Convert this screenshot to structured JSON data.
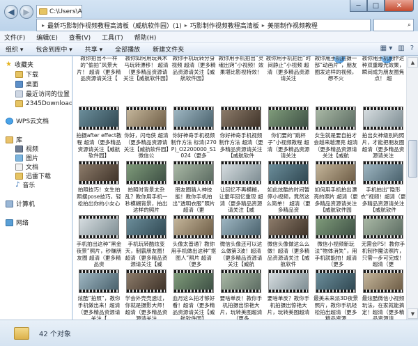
{
  "window": {
    "address_text": "C:\\Users\\Administrator\\",
    "minimize": "─",
    "maximize": "□",
    "close": "✕",
    "back": "◀",
    "forward": "▶"
  },
  "breadcrumb": {
    "items": [
      "最新巧影制作视频教程高清板（威航软件园）(1)",
      "巧影制作视频教程高清板",
      "美丽制作视频教程"
    ],
    "separator": "▸",
    "search_icon": "⌕"
  },
  "menu": {
    "items": [
      "文件(F)",
      "编辑(E)",
      "查看(V)",
      "工具(T)",
      "帮助(H)"
    ]
  },
  "commandbar": {
    "items": [
      "组织 ▾",
      "包含到库中 ▾",
      "共享 ▾",
      "全部播放",
      "新建文件夹"
    ],
    "view_icon": "▦ ▾",
    "pane_icon": "▥",
    "help_icon": "?"
  },
  "navigation": {
    "favorites": "收藏夹",
    "downloads": "下载",
    "desktop": "桌面",
    "recent": "最近访问的位置",
    "downloads2345": "2345Downloads",
    "wps_cloud": "WPS云文档",
    "libraries": "库",
    "videos": "视频",
    "pictures": "图片",
    "documents": "文档",
    "thunder": "迅雷下载",
    "music": "音乐",
    "computer": "计算机",
    "network": "网络"
  },
  "files": {
    "row1": [
      "教你拍出不一样的“偷拍”风景大片！ 超清（更多精品资源请关注【",
      "教你如何用玩具木马玩转漂移！ 超清（更多精品资源请关注【威航软件园】",
      "教你手机玩转分身视频 超清（更多精品资源请关注【威航软件园】",
      "教你用手机拍出“灵魂出窍”小视频！效果堪比影视特效！",
      "教你用手机拍出“时间静止”小视频 超清（更多精品资源请关注",
      "教你用手机拍摄一部“动画片”，朋友圈发这样的视频，想不火",
      "教你用手机制作这种双重曝光效果，瞬间成为朋友圈焦点！ 超"
    ],
    "row2": [
      "拍摄after effect教程 超清（更多精品资源请关注【威航软件园】",
      "你好，闪电侠 超清（更多精品资源请关注【威航软件园】微信公",
      "你好神奇手机视频制作方法 标清(270P)_O2200000_S1024（更多",
      "你好神奇手机视频制作方法 超清（更多精品资源请关注【威航软件",
      "你们要的“跳杯子”小视频教程 超清（更多精品资源请关注",
      "女生就是要自拍才会越来越漂亮 超清（更多精品资源请关注【威航",
      "拍出女神级别的照片，才能把朋友圈 超清（更多精品资源请关注"
    ],
    "row3": [
      "拍照技巧！女生拍照摆pose技巧，轻松拍出你的小女心",
      "拍照时背景太杂乱？教你用手机一秒模糊背景，拍出这样的照片",
      "朋友圈猜人神技能！教你手机拍出“透明衣服”照片 超清（更",
      "让回忆不再模糊，让童年回忆重现 超清（更多精品资源请关注【威",
      "如此炫酷的时间暂停小视频，竟然这么简单！ 超清（更多精品资",
      "如何用手机拍出漂亮的照片 超清（更多精品资源请关注【威航软件园",
      "手机拍出“隐形衣”视频！超清（更多精品资源请关注【威航软件"
    ],
    "row4": [
      "手机拍出这种“黑金夜景”照片，秒赚朋友圈 超清（更多精品资",
      "手机玩转酷炫变天，制霸朋友圈！超清（更多精品资源请关注【威",
      "头像太普通？教你用手机做出这种“抠图人”照片 超清（更多",
      "微信头像还可以这么做第3波！超清（更多精品资源请关注【威航",
      "微信头像做这么么做！超清（更多精品资源请关注【威航软件",
      "微信小视频新玩法“物体消失”，用手机就能拍！超清（更多",
      "无需会PS！教你手机制作魔法照片，只需一步可完成！超清（更"
    ],
    "row5": [
      "炫酷“拍照”，教你手机做出来！超清（更多精品资源请关注【",
      "学会外壳壳透过，你就是摄影大师！超清（更多精品资源请关注",
      "血月这么拍才够好看！超清（更多精品资源请关注【威航软件园】",
      "要啥单反！教你手机拍摄出惊艳大片，玩转美图超清（更多",
      "要啥单反？教你手机拍摄出惊艳大片，玩转美图超清",
      "最美未来派3D夜景照片，教你手机轻松拍出超清（更多精品资源",
      "最炫酷微信小视频玩法，在家就能搞定！超清（更多精品资源请"
    ]
  },
  "status": {
    "count": "42 个对象"
  }
}
